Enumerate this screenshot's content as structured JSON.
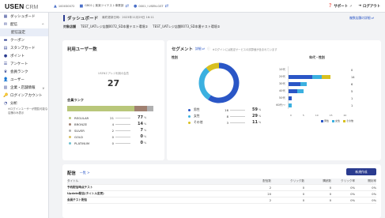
{
  "app": {
    "logo": "USEN",
    "logo_sub": "CRM"
  },
  "topbar": {
    "org_id": "100030072",
    "tenant": "GB01 | 楽楽ツイテスト事業部",
    "user": "0001 / USEN-GST",
    "support": "サポート",
    "logout": "ログアウト"
  },
  "sidebar": [
    {
      "label": "ダッシュボード",
      "icon": "dashboard-icon"
    },
    {
      "label": "配信",
      "icon": "send-icon",
      "caret": "^"
    },
    {
      "label": "配信設定",
      "sub": true
    },
    {
      "label": "クーポン",
      "icon": "coupon-icon"
    },
    {
      "label": "スタンプカード",
      "icon": "stamp-icon"
    },
    {
      "label": "ポイント",
      "icon": "point-icon"
    },
    {
      "label": "アンケート",
      "icon": "survey-icon"
    },
    {
      "label": "会員ランク",
      "icon": "rank-icon"
    },
    {
      "label": "ユーザー",
      "icon": "user-icon"
    },
    {
      "label": "企業・店舗情報",
      "icon": "store-icon",
      "caret": "v"
    },
    {
      "label": "ログインアカウント",
      "icon": "account-icon"
    },
    {
      "label": "分析",
      "icon": "analytics-icon"
    }
  ],
  "sidebar_note": "※ログインユーザーが閲覧可能な店舗のみ表示",
  "page": {
    "title": "ダッシュボード",
    "updated": "最終更新日時：2023年11月29日 16:11",
    "store_link": "複数店舗の詳細 ⇄",
    "store_label": "対象店舗",
    "store_1": "TEST_UATレジ店舗0072_SD本番テスト環境①",
    "store_2": "TEST_UATレジ店舗0073_SD本番テスト環境②"
  },
  "users": {
    "title": "利用ユーザー数",
    "subtitle": "USENエアレジ利用の会員",
    "count": "27",
    "rank_title": "会員ランク",
    "ranks": [
      {
        "name": "REGULAR",
        "value": "21",
        "pct": "77",
        "color": "#b9c77a"
      },
      {
        "name": "BRONZE",
        "value": "4",
        "pct": "14",
        "color": "#a08070"
      },
      {
        "name": "SILVER",
        "value": "2",
        "pct": "7",
        "color": "#b0b0b0"
      },
      {
        "name": "GOLD",
        "value": "0",
        "pct": "0",
        "color": "#d8c060"
      },
      {
        "name": "PLATINUM",
        "value": "0",
        "pct": "0",
        "color": "#70c0d0"
      }
    ]
  },
  "segment": {
    "title": "セグメント",
    "detail": "詳細 ⇄",
    "note": "※ログインには推定サービスの試算値が含まれています",
    "gender_label": "性別",
    "age_label": "年代・性別",
    "gender": [
      {
        "name": "男性",
        "value": "16",
        "pct": "59",
        "color": "#2a56c6"
      },
      {
        "name": "女性",
        "value": "8",
        "pct": "29",
        "color": "#3bb0e0"
      },
      {
        "name": "その他",
        "value": "3",
        "pct": "11",
        "color": "#d8c020"
      }
    ],
    "ages": [
      {
        "label": "10代",
        "total": "0",
        "m": 0,
        "f": 0,
        "o": 0
      },
      {
        "label": "20代",
        "total": "14",
        "m": 8,
        "f": 3,
        "o": 3
      },
      {
        "label": "30代",
        "total": "6",
        "m": 4,
        "f": 2,
        "o": 0
      },
      {
        "label": "40代",
        "total": "5",
        "m": 3,
        "f": 2,
        "o": 0
      },
      {
        "label": "50代",
        "total": "1",
        "m": 1,
        "f": 0,
        "o": 0
      },
      {
        "label": "60代〜",
        "total": "1",
        "m": 0,
        "f": 1,
        "o": 0
      }
    ],
    "age_legend": [
      "男性",
      "女性",
      "その他"
    ],
    "axis": [
      "0",
      "5",
      "10",
      "15",
      "20"
    ]
  },
  "delivery": {
    "title": "配信",
    "list_link": "一覧 >",
    "new_button": "新規作成",
    "columns": [
      "タイトル",
      "配信数",
      "クリック数",
      "購読数",
      "クリック率",
      "開封率"
    ],
    "rows": [
      [
        "予約配信時点テスト",
        "2",
        "0",
        "0",
        "0%",
        "0%"
      ],
      [
        "Update配信(タイトル変更)",
        "20",
        "0",
        "0",
        "0%",
        "0%"
      ],
      [
        "会員テスト配信",
        "2",
        "0",
        "0",
        "0%",
        "0%"
      ]
    ]
  },
  "colors": {
    "accent": "#2a3b8f",
    "male": "#2a56c6",
    "female": "#3bb0e0",
    "other": "#d8c020"
  }
}
